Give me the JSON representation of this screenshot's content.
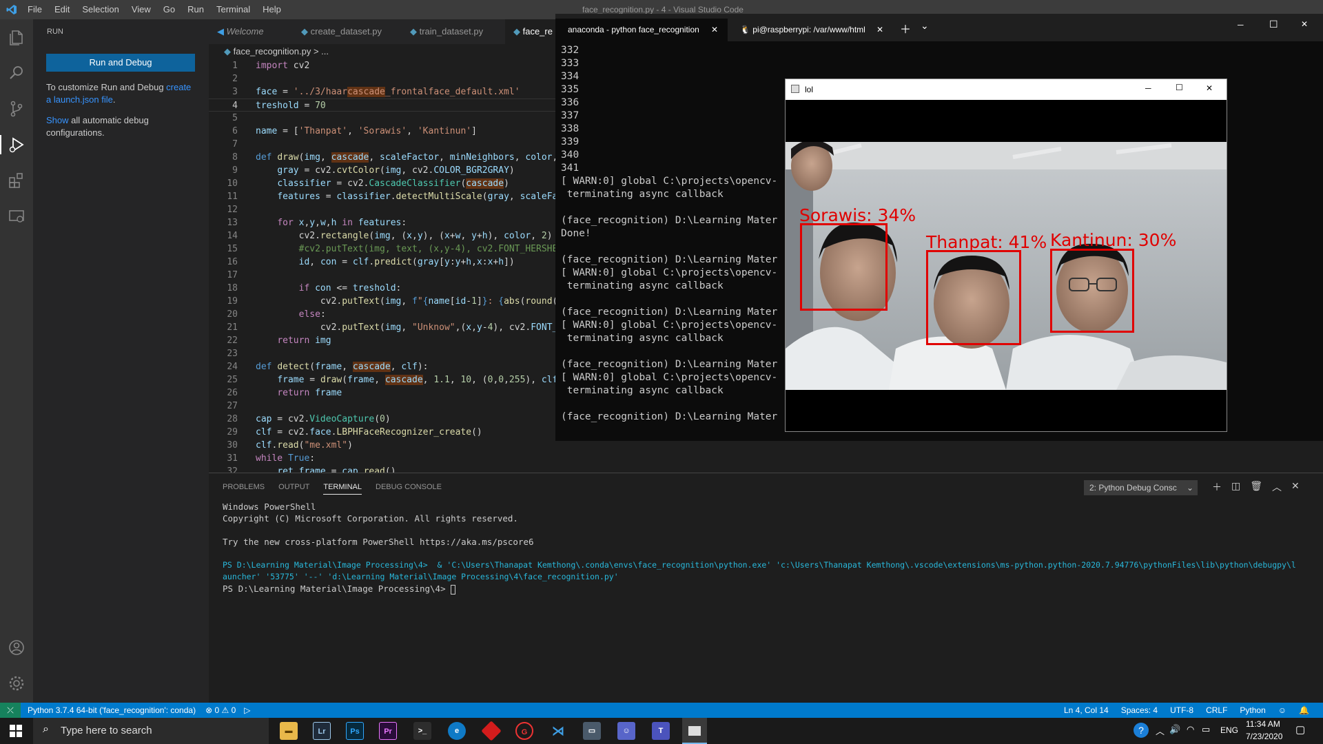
{
  "vscode": {
    "title": "face_recognition.py - 4 - Visual Studio Code",
    "menu": [
      "File",
      "Edit",
      "Selection",
      "View",
      "Go",
      "Run",
      "Terminal",
      "Help"
    ],
    "sidebar": {
      "header": "RUN",
      "run_button": "Run and Debug",
      "p1_text": "To customize Run and Debug ",
      "p1_link": "create a launch.json file",
      "p1_end": ".",
      "p2_link": "Show",
      "p2_text": " all automatic debug configurations."
    },
    "tabs": [
      "Welcome",
      "create_dataset.py",
      "train_dataset.py",
      "face_re"
    ],
    "breadcrumb": "face_recognition.py > ...",
    "code_lines": [
      "import cv2",
      "",
      "face = '../3/haarcascade_frontalface_default.xml'",
      "treshold = 70",
      "",
      "name = ['Thanpat', 'Sorawis', 'Kantinun']",
      "",
      "def draw(img, cascade, scaleFactor, minNeighbors, color,",
      "    gray = cv2.cvtColor(img, cv2.COLOR_BGR2GRAY)",
      "    classifier = cv2.CascadeClassifier(cascade)",
      "    features = classifier.detectMultiScale(gray, scaleFac",
      "",
      "    for x,y,w,h in features:",
      "        cv2.rectangle(img, (x,y), (x+w, y+h), color, 2)",
      "        #cv2.putText(img, text, (x,y-4), cv2.FONT_HERSHEY",
      "        id, con = clf.predict(gray[y:y+h,x:x+h])",
      "",
      "        if con <= treshold:",
      "            cv2.putText(img, f\"{name[id-1]}: {abs(round(1",
      "        else:",
      "            cv2.putText(img, \"Unknow\",(x,y-4), cv2.FONT_H",
      "    return img",
      "",
      "def detect(frame, cascade, clf):",
      "    frame = draw(frame, cascade, 1.1, 10, (0,0,255), clf)",
      "    return frame",
      "",
      "cap = cv2.VideoCapture(0)",
      "clf = cv2.face.LBPHFaceRecognizer_create()",
      "clf.read(\"me.xml\")",
      "while True:",
      "    ret,frame = cap.read()"
    ],
    "panel": {
      "tabs": [
        "PROBLEMS",
        "OUTPUT",
        "TERMINAL",
        "DEBUG CONSOLE"
      ],
      "dropdown": "2: Python Debug Consc",
      "terminal_lines": [
        "Windows PowerShell",
        "Copyright (C) Microsoft Corporation. All rights reserved.",
        "",
        "Try the new cross-platform PowerShell https://aka.ms/pscore6",
        "",
        "PS D:\\Learning Material\\Image Processing\\4>  & 'C:\\Users\\Thanapat Kemthong\\.conda\\envs\\face_recognition\\python.exe' 'c:\\Users\\Thanapat Kemthong\\.vscode\\extensions\\ms-python.python-2020.7.94776\\pythonFiles\\lib\\python\\debugpy\\l",
        "auncher' '53775' '--' 'd:\\Learning Material\\Image Processing\\4\\face_recognition.py'",
        "PS D:\\Learning Material\\Image Processing\\4> "
      ]
    },
    "status": {
      "python": "Python 3.7.4 64-bit ('face_recognition': conda)",
      "problems": "⊗ 0 ⚠ 0",
      "position": "Ln 4, Col 14",
      "spaces": "Spaces: 4",
      "encoding": "UTF-8",
      "eol": "CRLF",
      "language": "Python"
    }
  },
  "windows_terminal": {
    "tab1": "anaconda - python  face_recognition",
    "tab2": "pi@raspberrypi: /var/www/html",
    "lines": [
      "332",
      "333",
      "334",
      "335",
      "336",
      "337",
      "338",
      "339",
      "340",
      "341",
      "[ WARN:0] global C:\\projects\\opencv-                                                     ourceReaderCB",
      " terminating async callback",
      "",
      "(face_recognition) D:\\Learning Mater",
      "Done!",
      "",
      "(face_recognition) D:\\Learning Mater",
      "[ WARN:0] global C:\\projects\\opencv-                                                     ourceReaderCB",
      " terminating async callback",
      "",
      "(face_recognition) D:\\Learning Mater",
      "[ WARN:0] global C:\\projects\\opencv-                                                     ourceReaderCB",
      " terminating async callback",
      "",
      "(face_recognition) D:\\Learning Mater",
      "[ WARN:0] global C:\\projects\\opencv-                                                     ourceReaderCB",
      " terminating async callback",
      "",
      "(face_recognition) D:\\Learning Mater"
    ]
  },
  "lol_window": {
    "title": "lol",
    "labels": [
      "Sorawis: 34%",
      "Thanpat: 41%",
      "Kantinun: 30%"
    ]
  },
  "taskbar": {
    "search_placeholder": "Type here to search",
    "lang": "ENG",
    "time": "11:34 AM",
    "date": "7/23/2020"
  },
  "colors": {
    "accent": "#007acc",
    "face_box": "#e00000"
  }
}
